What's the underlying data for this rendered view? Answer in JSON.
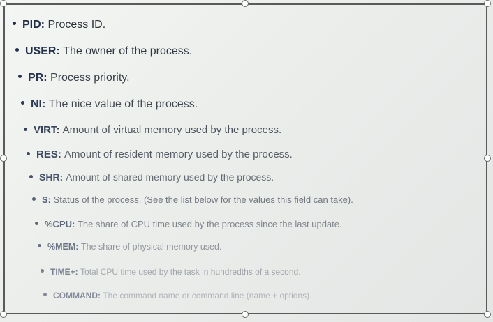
{
  "items": [
    {
      "term": "PID:",
      "desc": "Process ID."
    },
    {
      "term": "USER:",
      "desc": "The owner of the process."
    },
    {
      "term": "PR:",
      "desc": "Process priority."
    },
    {
      "term": "NI:",
      "desc": "The nice value of the process."
    },
    {
      "term": "VIRT:",
      "desc": "Amount of virtual memory used by the process."
    },
    {
      "term": "RES:",
      "desc": "Amount of resident memory used by the process."
    },
    {
      "term": "SHR:",
      "desc": "Amount of shared memory used by the process."
    },
    {
      "term": "S:",
      "desc": "Status of the process. (See the list below for the values this field can take)."
    },
    {
      "term": "%CPU:",
      "desc": "The share of CPU time used by the process since the last update."
    },
    {
      "term": "%MEM:",
      "desc": "The share of physical memory used."
    },
    {
      "term": "TIME+:",
      "desc": "Total CPU time used by the task in hundredths of a second."
    },
    {
      "term": "COMMAND:",
      "desc": "The command name or command line (name + options)."
    }
  ],
  "colors": {
    "term_start": "#1c2a44",
    "desc_start": "#2a2f38",
    "fade_end": "#b9bec4"
  }
}
